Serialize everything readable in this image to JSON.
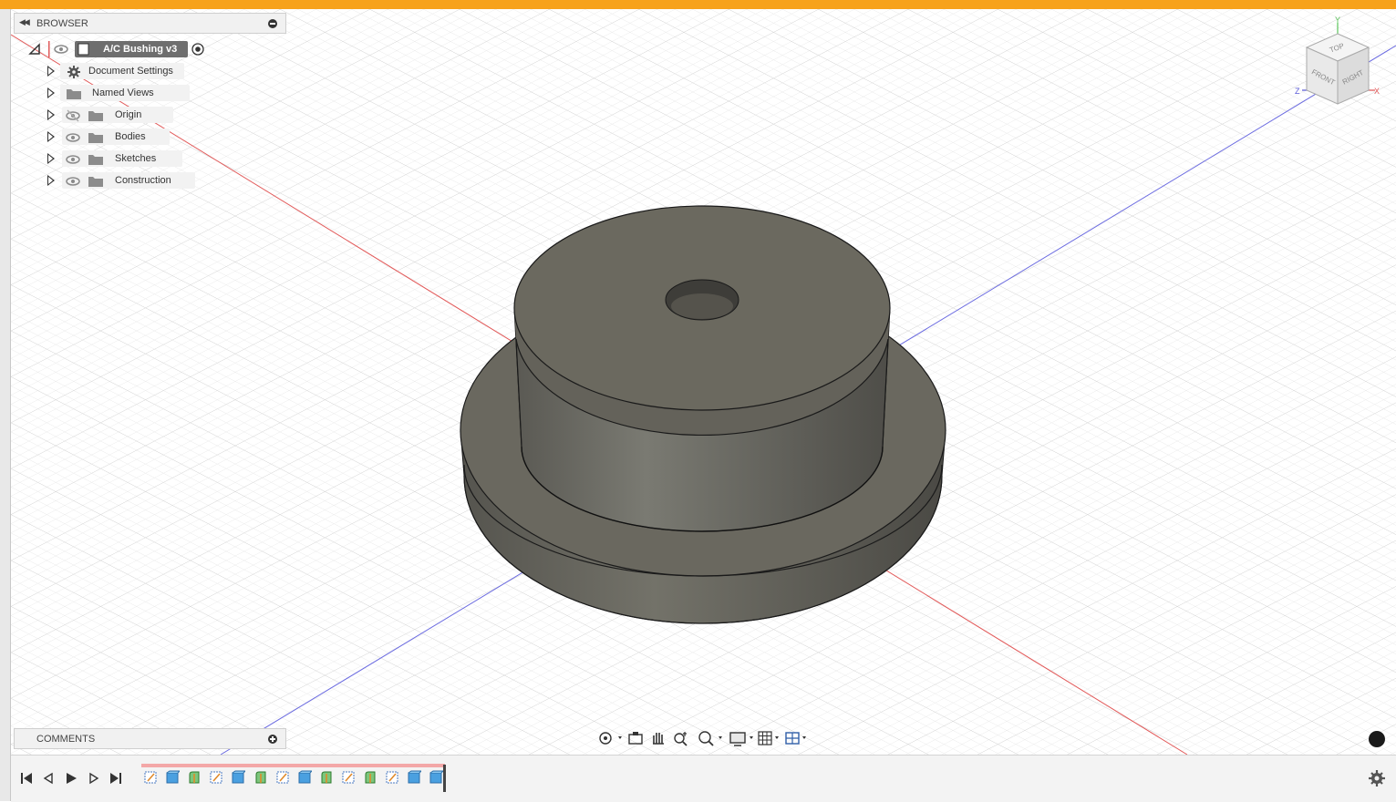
{
  "colors": {
    "top_bar": "#f7a21b",
    "x_axis": "#e25a5a",
    "z_axis": "#5b5bd8",
    "y_axis": "#5ac45a",
    "body": "#6c6a62"
  },
  "browser": {
    "title": "BROWSER",
    "root": {
      "label": "A/C Bushing v3"
    },
    "items": [
      {
        "label": "Document Settings",
        "icon": "gear-icon"
      },
      {
        "label": "Named Views",
        "icon": "folder-icon"
      },
      {
        "label": "Origin",
        "icon": "folder-icon",
        "visibility": "hidden-eye-icon"
      },
      {
        "label": "Bodies",
        "icon": "folder-icon",
        "visibility": "eye-icon"
      },
      {
        "label": "Sketches",
        "icon": "folder-icon",
        "visibility": "eye-icon"
      },
      {
        "label": "Construction",
        "icon": "folder-icon",
        "visibility": "eye-icon"
      }
    ]
  },
  "comments": {
    "title": "COMMENTS"
  },
  "viewcube": {
    "top": "TOP",
    "front": "FRONT",
    "right": "RIGHT",
    "x": "X",
    "y": "Y",
    "z": "Z"
  },
  "navbar": {
    "tools": [
      "orbit-icon",
      "look-at-icon",
      "pan-icon",
      "zoom-icon",
      "fit-icon",
      "display-settings-icon",
      "grid-icon",
      "viewports-icon"
    ]
  },
  "timeline": {
    "controls": [
      "first-icon",
      "previous-icon",
      "play-icon",
      "next-icon",
      "last-icon"
    ],
    "features": [
      "sketch",
      "extrude",
      "fillet",
      "sketch",
      "extrude",
      "fillet",
      "sketch",
      "extrude",
      "fillet",
      "sketch",
      "fillet",
      "sketch",
      "extrude",
      "extrude"
    ]
  }
}
